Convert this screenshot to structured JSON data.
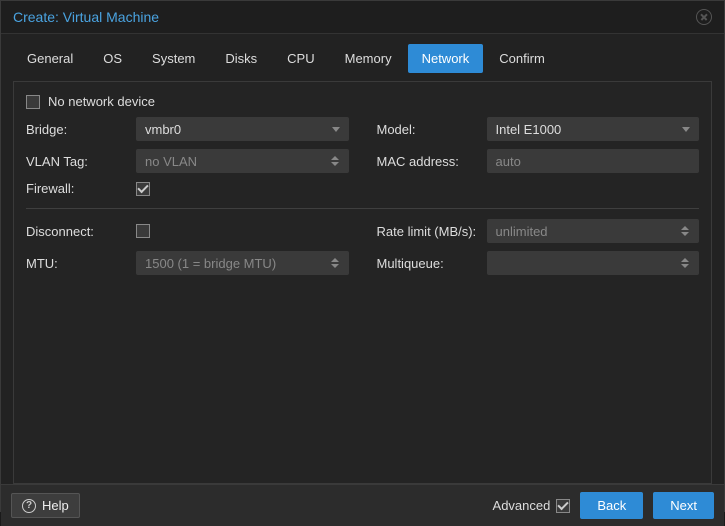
{
  "window": {
    "title": "Create: Virtual Machine"
  },
  "tabs": [
    "General",
    "OS",
    "System",
    "Disks",
    "CPU",
    "Memory",
    "Network",
    "Confirm"
  ],
  "active_tab": "Network",
  "network": {
    "no_device_label": "No network device",
    "no_device_checked": false,
    "bridge_label": "Bridge:",
    "bridge_value": "vmbr0",
    "vlan_label": "VLAN Tag:",
    "vlan_placeholder": "no VLAN",
    "firewall_label": "Firewall:",
    "firewall_checked": true,
    "model_label": "Model:",
    "model_value": "Intel E1000",
    "mac_label": "MAC address:",
    "mac_placeholder": "auto",
    "disconnect_label": "Disconnect:",
    "disconnect_checked": false,
    "mtu_label": "MTU:",
    "mtu_placeholder": "1500 (1 = bridge MTU)",
    "rate_label": "Rate limit (MB/s):",
    "rate_placeholder": "unlimited",
    "multiqueue_label": "Multiqueue:"
  },
  "footer": {
    "help": "Help",
    "advanced": "Advanced",
    "advanced_checked": true,
    "back": "Back",
    "next": "Next"
  }
}
